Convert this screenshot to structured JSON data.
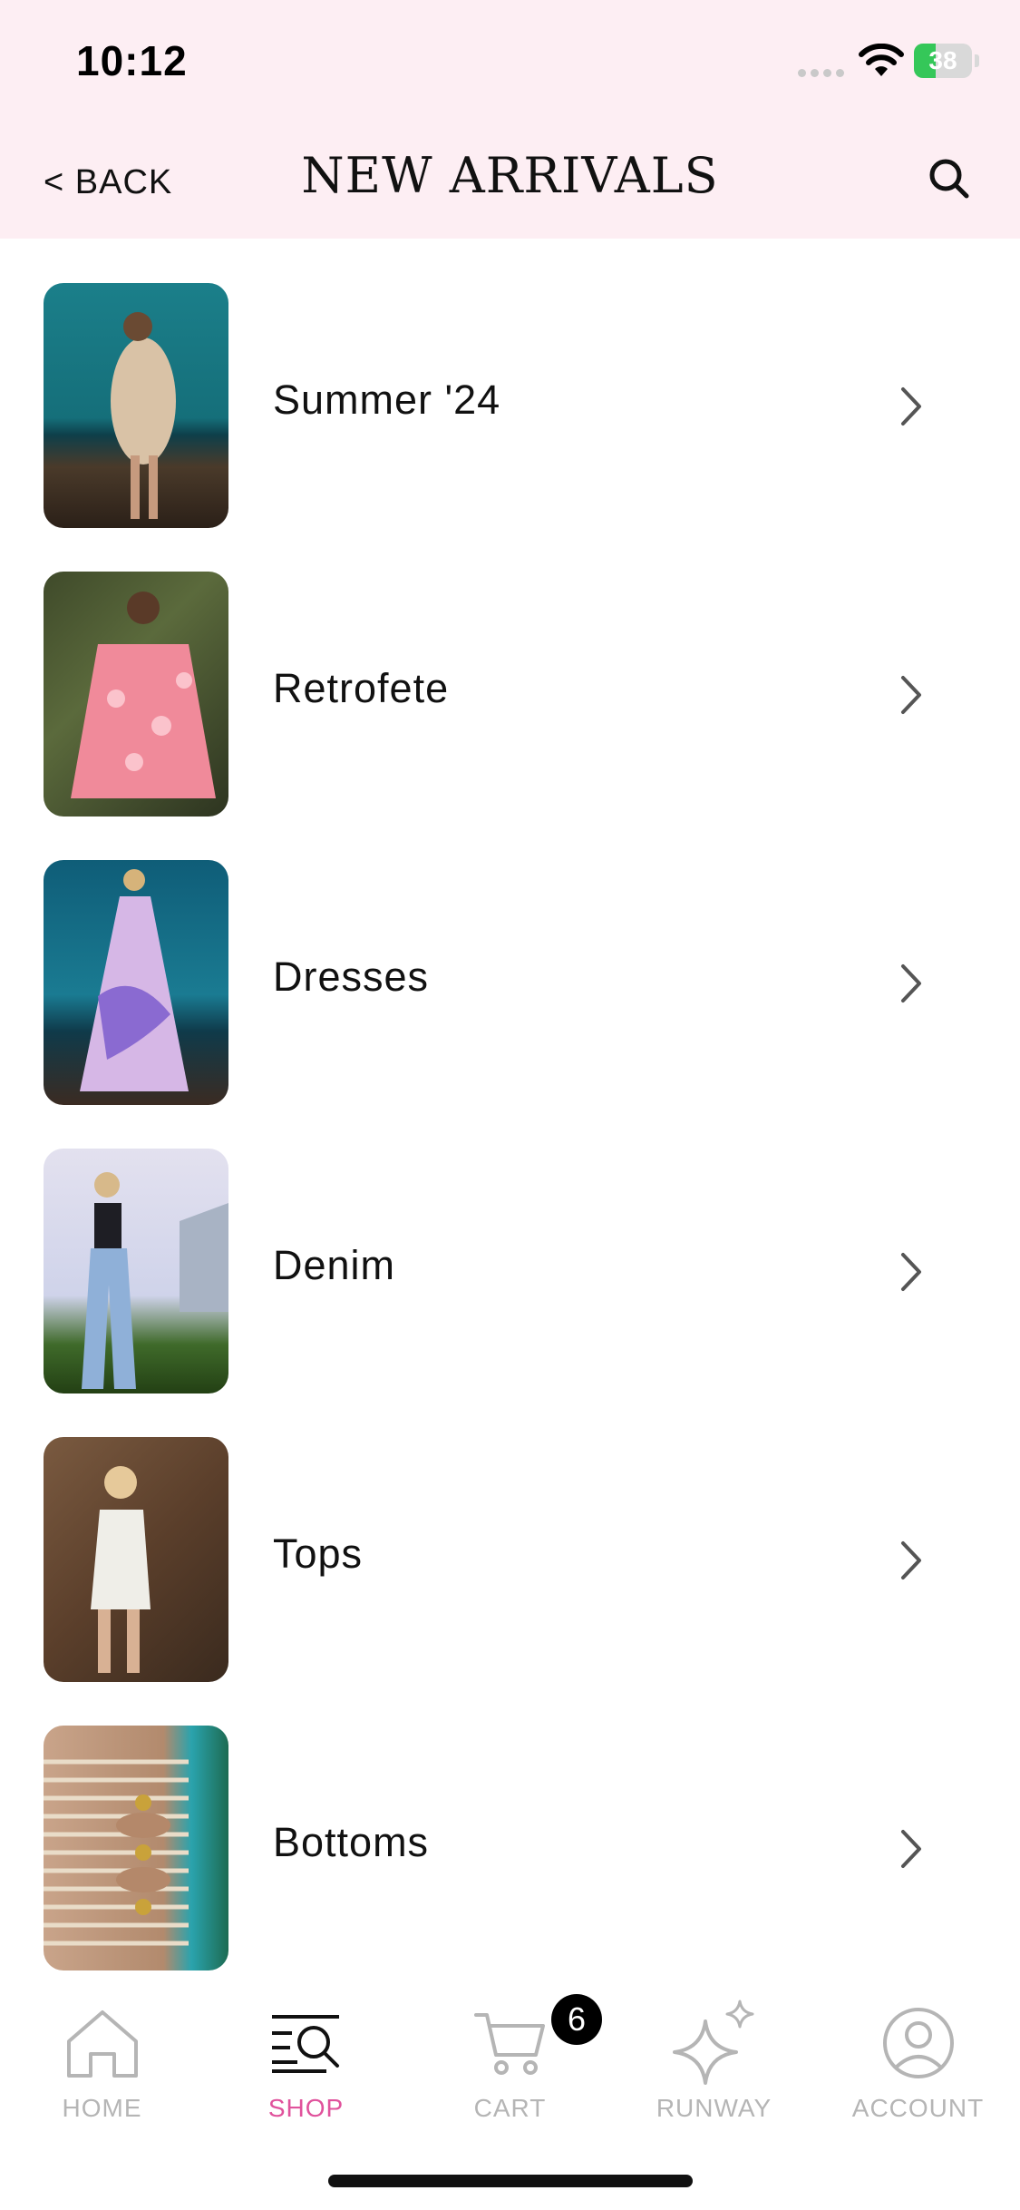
{
  "status": {
    "time": "10:12",
    "battery": "38",
    "battery_level": 0.38
  },
  "header": {
    "back_label": "< BACK",
    "title": "NEW ARRIVALS"
  },
  "categories": [
    {
      "label": "Summer '24"
    },
    {
      "label": "Retrofete"
    },
    {
      "label": "Dresses"
    },
    {
      "label": "Denim"
    },
    {
      "label": "Tops"
    },
    {
      "label": "Bottoms"
    }
  ],
  "tabs": [
    {
      "label": "HOME",
      "icon": "home-icon"
    },
    {
      "label": "SHOP",
      "icon": "shop-search-icon",
      "active": true
    },
    {
      "label": "CART",
      "icon": "cart-icon",
      "badge": "6"
    },
    {
      "label": "RUNWAY",
      "icon": "sparkle-icon"
    },
    {
      "label": "ACCOUNT",
      "icon": "account-icon"
    }
  ],
  "colors": {
    "header_bg": "#fdeef3",
    "active_tab": "#e0529c",
    "inactive_tab": "#b5b5b5",
    "battery": "#35c759"
  }
}
